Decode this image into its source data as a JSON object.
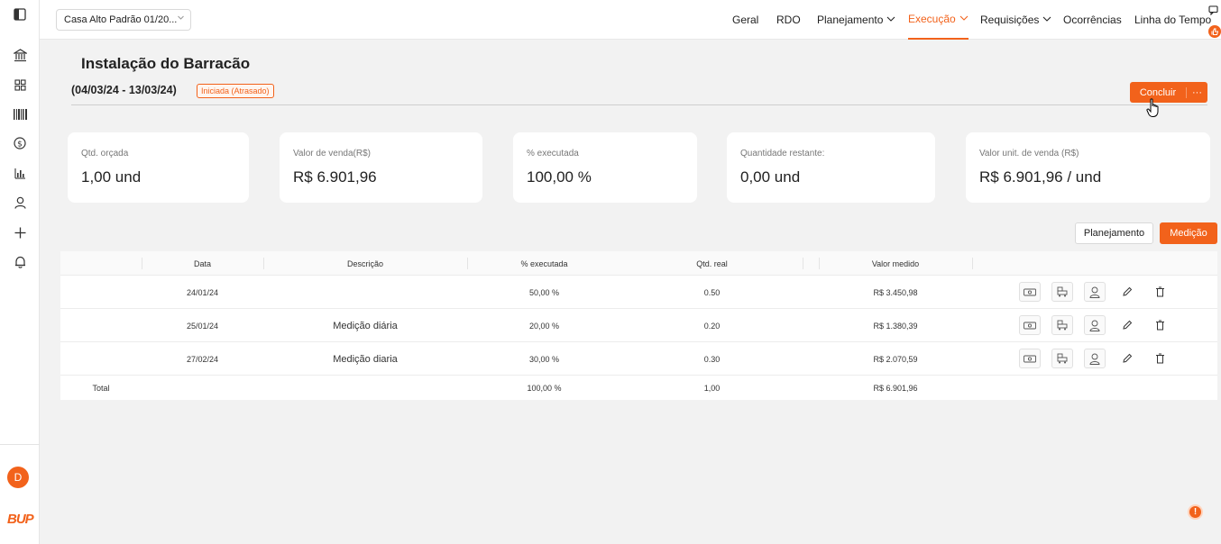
{
  "sidebar": {
    "icons": [
      "panel-toggle-icon",
      "bank-icon",
      "grid-icon",
      "barcode-icon",
      "dollar-icon",
      "bar-chart-icon",
      "user-icon",
      "plus-icon",
      "bell-icon"
    ],
    "avatar_initial": "D",
    "logo_text": "BUP"
  },
  "topbar": {
    "project": "Casa Alto Padrão 01/20...",
    "nav": [
      {
        "label": "Geral"
      },
      {
        "label": "RDO"
      },
      {
        "label": "Planejamento"
      },
      {
        "label": "Execução"
      },
      {
        "label": "Requisições"
      },
      {
        "label": "Ocorrências"
      },
      {
        "label": "Linha do Tempo"
      }
    ]
  },
  "header": {
    "title": "Instalação do Barracão",
    "date_range": "(04/03/24 - 13/03/24)",
    "status": "Iniciada (Atrasado)",
    "conclude_label": "Concluir",
    "more_label": "···"
  },
  "cards": [
    {
      "label": "Qtd. orçada",
      "value": "1,00 und"
    },
    {
      "label": "Valor de venda(R$)",
      "value": "R$ 6.901,96"
    },
    {
      "label": "% executada",
      "value": "100,00 %"
    },
    {
      "label": "Quantidade restante:",
      "value": "0,00 und"
    },
    {
      "label": "Valor unit. de venda (R$)",
      "value": "R$ 6.901,96 / und"
    }
  ],
  "tabs": {
    "planejamento": "Planejamento",
    "medicao": "Medição"
  },
  "table": {
    "headers": {
      "data": "Data",
      "descricao": "Descrição",
      "executada": "% executada",
      "qtd_real": "Qtd. real",
      "valor": "Valor medido"
    },
    "rows": [
      {
        "data": "24/01/24",
        "descricao": "",
        "executada": "50,00 %",
        "qtd_real": "0.50",
        "valor": "R$ 3.450,98"
      },
      {
        "data": "25/01/24",
        "descricao": "Medição diária",
        "executada": "20,00 %",
        "qtd_real": "0.20",
        "valor": "R$ 1.380,39"
      },
      {
        "data": "27/02/24",
        "descricao": "Medição diaria",
        "executada": "30,00 %",
        "qtd_real": "0.30",
        "valor": "R$ 2.070,59"
      }
    ],
    "total": {
      "label": "Total",
      "executada": "100,00 %",
      "qtd_real": "1,00",
      "valor": "R$ 6.901,96"
    }
  },
  "help_icon": "!",
  "accent_color": "#f2621b"
}
